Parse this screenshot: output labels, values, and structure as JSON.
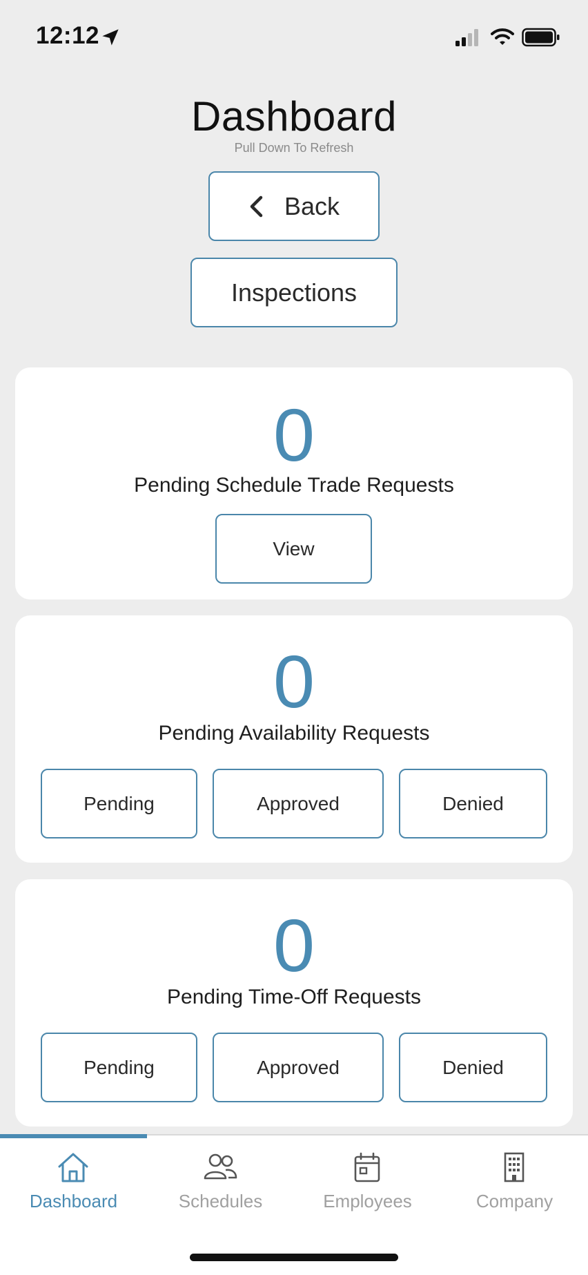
{
  "status_bar": {
    "time": "12:12"
  },
  "header": {
    "title": "Dashboard",
    "subtitle": "Pull Down To Refresh"
  },
  "nav": {
    "back_label": "Back",
    "inspections_label": "Inspections"
  },
  "cards": [
    {
      "count": "0",
      "label": "Pending Schedule Trade Requests",
      "buttons": [
        "View"
      ]
    },
    {
      "count": "0",
      "label": "Pending Availability Requests",
      "buttons": [
        "Pending",
        "Approved",
        "Denied"
      ]
    },
    {
      "count": "0",
      "label": "Pending Time-Off Requests",
      "buttons": [
        "Pending",
        "Approved",
        "Denied"
      ]
    }
  ],
  "tabs": [
    {
      "label": "Dashboard",
      "icon": "home-icon",
      "active": true
    },
    {
      "label": "Schedules",
      "icon": "people-icon",
      "active": false
    },
    {
      "label": "Employees",
      "icon": "calendar-icon",
      "active": false
    },
    {
      "label": "Company",
      "icon": "building-icon",
      "active": false
    }
  ],
  "colors": {
    "accent": "#4a8bb3",
    "border": "#4a86aa",
    "background": "#ededed",
    "card": "#ffffff"
  }
}
